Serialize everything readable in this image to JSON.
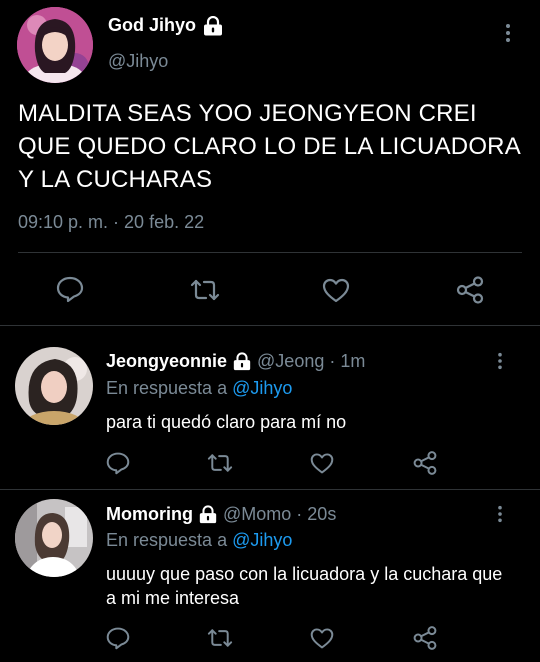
{
  "colors": {
    "background": "#000000",
    "text": "#ffffff",
    "muted": "#7b8a96",
    "link": "#1d9bf0",
    "separator": "#2f3336"
  },
  "main_tweet": {
    "name": "God Jihyo",
    "handle": "@Jihyo",
    "text": "MALDITA SEAS YOO JEONGYEON CREI QUE QUEDO CLARO LO DE LA LICUADORA Y LA CUCHARAS",
    "timestamp": "09:10 p. m. · 20 feb. 22",
    "icons": [
      "reply-icon",
      "retweet-icon",
      "like-icon",
      "share-icon"
    ]
  },
  "replies": [
    {
      "name": "Jeongyeonnie",
      "handle": "@Jeong",
      "time": "· 1m",
      "reply_prefix": "En respuesta a",
      "reply_to": "@Jihyo",
      "text": "para ti quedó claro para mí no"
    },
    {
      "name": "Momoring",
      "handle": "@Momo",
      "time": "· 20s",
      "reply_prefix": "En respuesta a",
      "reply_to": "@Jihyo",
      "text": "uuuuy que paso con la licuadora y la cuchara que a mi me interesa"
    }
  ]
}
